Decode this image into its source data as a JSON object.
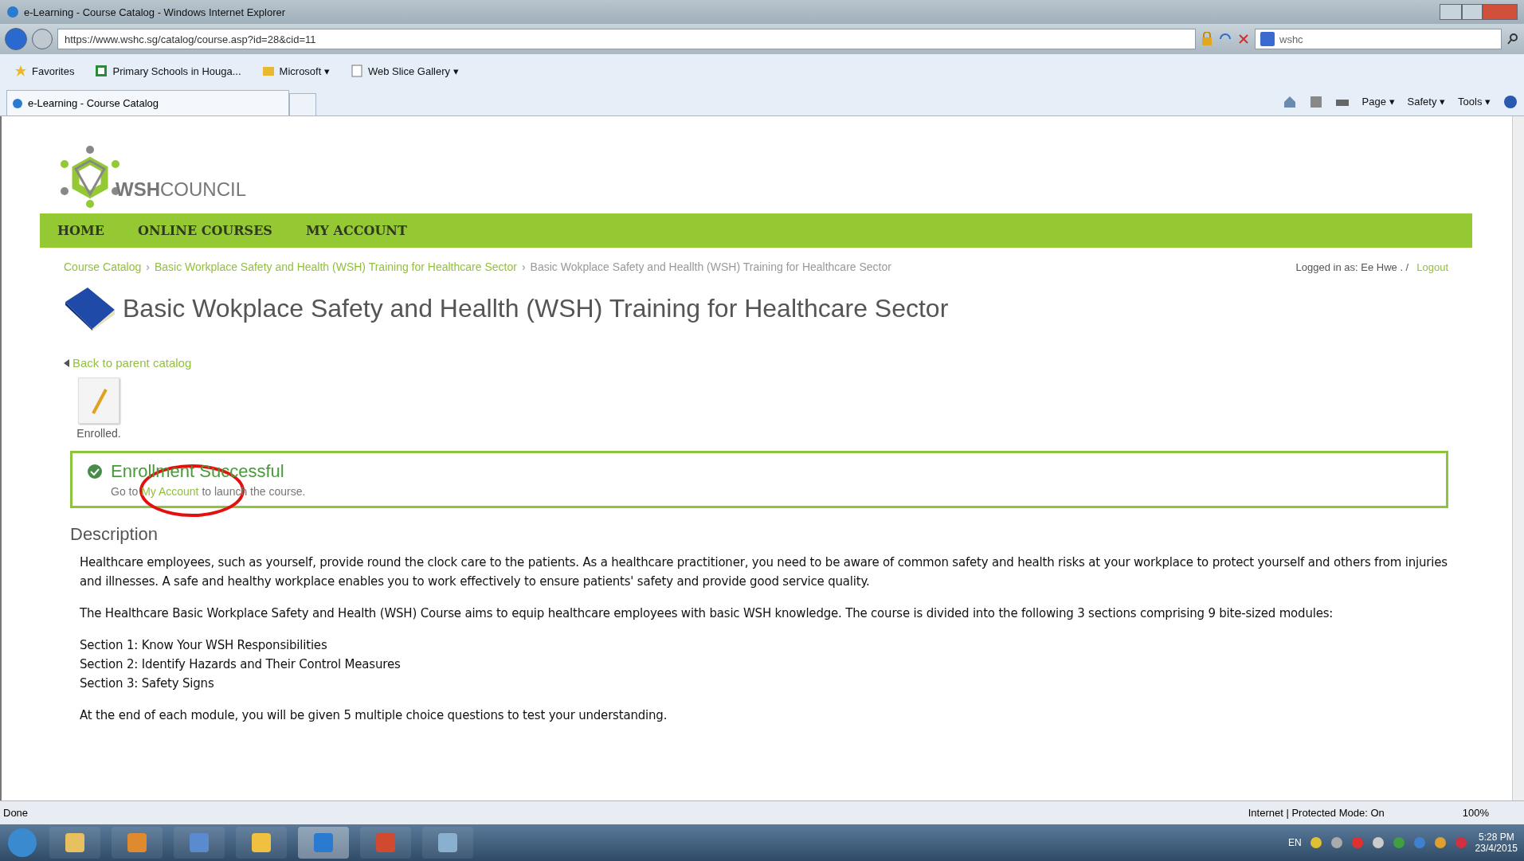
{
  "window": {
    "title": "e-Learning - Course Catalog - Windows Internet Explorer"
  },
  "address_bar": {
    "url": "https://www.wshc.sg/catalog/course.asp?id=28&cid=11",
    "search": "wshc"
  },
  "favorites_bar": {
    "items": [
      {
        "label": "Favorites",
        "kind": "star"
      },
      {
        "label": "Primary Schools in Houga...",
        "kind": "page"
      },
      {
        "label": "Microsoft ▾",
        "kind": "folder"
      },
      {
        "label": "Web Slice Gallery ▾",
        "kind": "slice"
      }
    ]
  },
  "tab": {
    "label": "e-Learning - Course Catalog"
  },
  "command_bar": [
    "Page ▾",
    "Safety ▾",
    "Tools ▾"
  ],
  "site": {
    "logo": {
      "bold": "WSH",
      "rest": "COUNCIL"
    },
    "nav": [
      "HOME",
      "ONLINE COURSES",
      "MY ACCOUNT"
    ],
    "breadcrumb": [
      {
        "label": "Course Catalog",
        "link": true
      },
      {
        "separator": "›",
        "label": "Basic Workplace Safety and Health (WSH) Training for Healthcare Sector",
        "link": true
      },
      {
        "separator": "›",
        "label": "Basic Wokplace Safety and Heallth (WSH) Training for Healthcare Sector",
        "link": false
      }
    ],
    "login": {
      "text": "Logged in as: Ee Hwe . /",
      "link": "Logout"
    },
    "page_title": "Basic Wokplace Safety and Heallth (WSH) Training for Healthcare Sector",
    "back_link": "Back to parent catalog",
    "status": "Enrolled.",
    "alert": {
      "title": "Enrollment Successful",
      "before": "Go to",
      "link": "My Account",
      "after": "to launch the course."
    },
    "description": {
      "heading": "Description",
      "paragraphs": [
        [
          "Healthcare employees, such as yourself, provide round the clock care to the patients. As a healthcare practitioner, you need to be aware of common safety and health risks at your workplace to protect yourself and others from injuries and illnesses. A safe and healthy workplace enables you to work effectively to ensure patients' safety and provide good service quality."
        ],
        [
          "The Healthcare Basic Workplace Safety and Health (WSH) Course aims to equip healthcare employees with basic WSH knowledge. The course is divided into the following 3 sections comprising 9 bite-sized modules:"
        ],
        [
          "Section 1: Know Your WSH Responsibilities",
          "Section 2: Identify Hazards and Their Control Measures",
          "Section 3: Safety Signs"
        ],
        [
          "At the end of each module, you will be given 5 multiple choice questions to test your understanding."
        ]
      ]
    }
  },
  "status_bar": {
    "text": "Done",
    "zone": "Internet | Protected Mode: On",
    "zoom": "100%"
  },
  "taskbar": {
    "language": "EN",
    "time": "5:28 PM",
    "date": "23/4/2015"
  }
}
